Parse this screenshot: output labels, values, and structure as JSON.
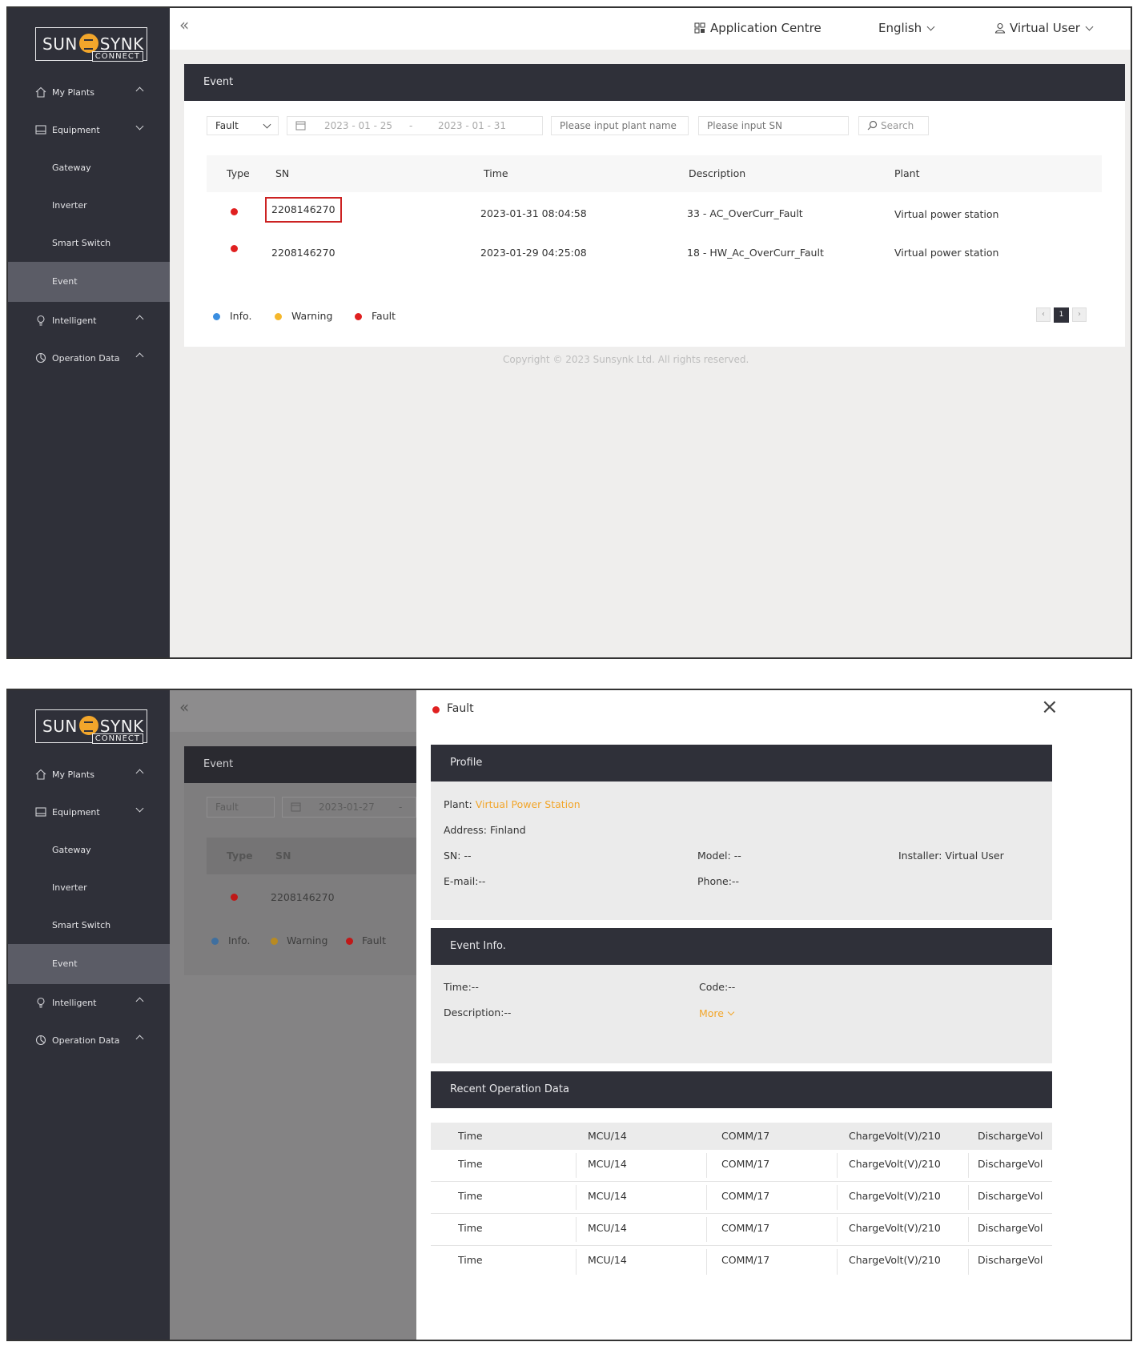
{
  "brand": {
    "name_left": "SUN",
    "name_right": "SYNK",
    "sub": "CONNECT"
  },
  "nav": [
    {
      "label": "My Plants",
      "chevron": "up",
      "icon": "home-icon"
    },
    {
      "label": "Equipment",
      "chevron": "down",
      "icon": "equipment-icon"
    },
    {
      "label": "Gateway",
      "sub": true
    },
    {
      "label": "Inverter",
      "sub": true
    },
    {
      "label": "Smart Switch",
      "sub": true
    },
    {
      "label": "Event",
      "sub": true,
      "active": true
    },
    {
      "label": "Intelligent",
      "chevron": "up",
      "icon": "bulb-icon"
    },
    {
      "label": "Operation Data",
      "chevron": "up",
      "icon": "chart-icon"
    }
  ],
  "topbar": {
    "collapse": "«",
    "app_centre": "Application Centre",
    "language": "English",
    "user": "Virtual User"
  },
  "event_page": {
    "title": "Event",
    "filter": {
      "type": "Fault",
      "date_from": "2023 - 01 - 25",
      "date_sep": "-",
      "date_to": "2023 - 01 - 31",
      "plant_placeholder": "Please input plant name",
      "sn_placeholder": "Please input SN",
      "search": "Search"
    },
    "columns": [
      "Type",
      "SN",
      "Time",
      "Description",
      "Plant"
    ],
    "rows": [
      {
        "sn": "2208146270",
        "time": "2023-01-31 08:04:58",
        "description": "33 - AC_OverCurr_Fault",
        "plant": "Virtual power station"
      },
      {
        "sn": "2208146270",
        "time": "2023-01-29 04:25:08",
        "description": "18 -  HW_Ac_OverCurr_Fault",
        "plant": "Virtual power station"
      }
    ],
    "legend": [
      "Info.",
      "Warning",
      "Fault"
    ],
    "pager": {
      "prev": "‹",
      "current": "1",
      "next": "›"
    },
    "copyright": "Copyright © 2023 Sunsynk Ltd. All rights reserved."
  },
  "dimmed": {
    "title": "Event",
    "type": "Fault",
    "date": "2023-01-27",
    "date_sep": "-",
    "col_type": "Type",
    "col_sn": "SN",
    "sn": "2208146270",
    "legend": [
      "Info.",
      "Warning",
      "Fault"
    ]
  },
  "drawer": {
    "title": "Fault",
    "close": "×",
    "profile": {
      "title": "Profile",
      "plant_label": "Plant:",
      "plant_value": "Virtual Power Station",
      "address": "Address: Finland",
      "sn": "SN: --",
      "model": "Model: --",
      "installer": "Installer: Virtual User",
      "email": "E-mail:--",
      "phone": "Phone:--"
    },
    "event_info": {
      "title": "Event Info.",
      "time": "Time:--",
      "code": "Code:--",
      "description": "Description:--",
      "more": "More"
    },
    "recent": {
      "title": "Recent Operation Data",
      "header": [
        "Time",
        "MCU/14",
        "COMM/17",
        "ChargeVolt(V)/210",
        "DischargeVol"
      ],
      "rows": [
        [
          "Time",
          "MCU/14",
          "COMM/17",
          "ChargeVolt(V)/210",
          "DischargeVol"
        ],
        [
          "Time",
          "MCU/14",
          "COMM/17",
          "ChargeVolt(V)/210",
          "DischargeVol"
        ],
        [
          "Time",
          "MCU/14",
          "COMM/17",
          "ChargeVolt(V)/210",
          "DischargeVol"
        ],
        [
          "Time",
          "MCU/14",
          "COMM/17",
          "ChargeVolt(V)/210",
          "DischargeVol"
        ]
      ]
    }
  },
  "colors": {
    "sidebar": "#2f3039",
    "active": "#5b5c66",
    "accent": "#f2a62b",
    "fault": "#e02020",
    "warning": "#f5b72b",
    "info": "#3a8ee0",
    "highlight": "#cc2222"
  }
}
